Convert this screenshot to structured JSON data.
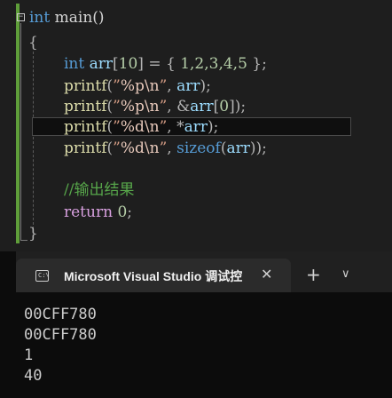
{
  "editor": {
    "fold_glyph": "−",
    "lines": {
      "l1": {
        "kw": "int",
        "rest": " main()"
      },
      "l2": {
        "text": "{"
      },
      "l3": {
        "kw": "int",
        "var": "arr",
        "p1": "[",
        "n1": "10",
        "p2": "] = { ",
        "n2": "1,2,3,4,5",
        "p3": " };"
      },
      "l4": {
        "fn": "printf",
        "p1": "(",
        "s1": "”",
        "e1": "%p\\n",
        "s2": "”",
        "p2": ", ",
        "v": "arr",
        "p3": ");"
      },
      "l5": {
        "fn": "printf",
        "p1": "(",
        "s1": "”",
        "e1": "%p\\n",
        "s2": "”",
        "p2": ", ",
        "amp": "&",
        "v": "arr",
        "p3": "[",
        "n": "0",
        "p4": "]);"
      },
      "l6": {
        "fn": "printf",
        "p1": "(",
        "s1": "”",
        "e1": "%d\\n",
        "s2": "”",
        "p2": ", ",
        "star": "*",
        "v": "arr",
        "p3": ");"
      },
      "l7": {
        "fn": "printf",
        "p1": "(",
        "s1": "”",
        "e1": "%d\\n",
        "s2": "”",
        "p2": ", ",
        "kw": "sizeof",
        "p3": "(",
        "v": "arr",
        "p4": "));"
      },
      "l8": {
        "comment": "//输出结果"
      },
      "l9": {
        "ctl": "return",
        "sp": " ",
        "n": "0",
        "p": ";"
      },
      "l10": {
        "text": "}"
      }
    }
  },
  "terminal": {
    "tab_title": "Microsoft Visual Studio 调试控",
    "tab_icon_text": "C:\\",
    "close_glyph": "✕",
    "plus_glyph": "+",
    "chevron_glyph": "∨",
    "output": [
      "00CFF780",
      "00CFF780",
      "1",
      "40"
    ]
  }
}
